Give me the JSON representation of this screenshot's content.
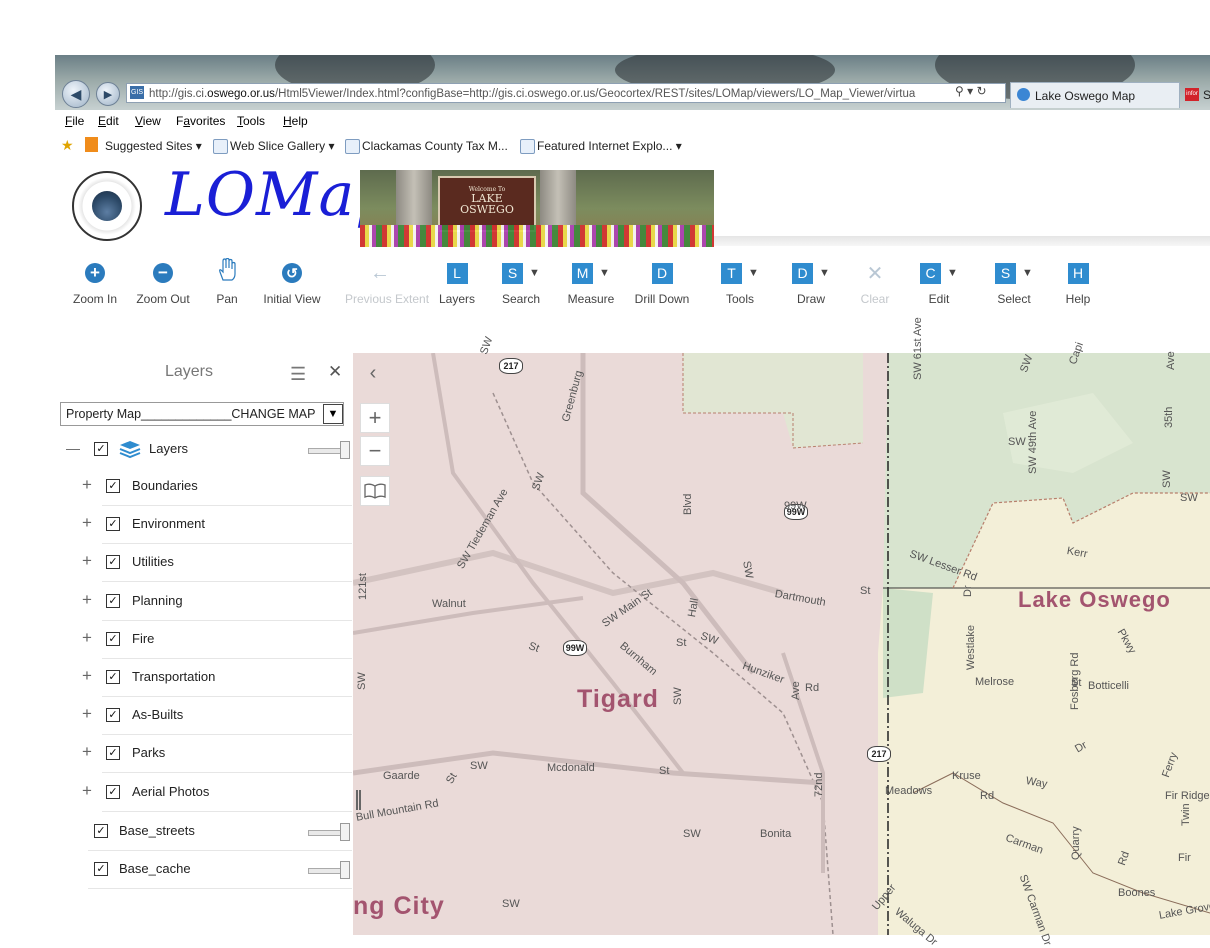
{
  "browser": {
    "url_prefix": "http://gis.ci.",
    "url_domain": "oswego.or.us",
    "url_suffix": "/Html5Viewer/Index.html?configBase=http://gis.ci.oswego.or.us/Geocortex/REST/sites/LOMap/viewers/LO_Map_Viewer/virtua",
    "addr_tools": "⚲ ▾ ↻",
    "site_icon_text": "GIS",
    "active_tab": "Lake Oswego Map",
    "second_tab": "S",
    "second_tab_icon_text": "infor",
    "menu": [
      "File",
      "Edit",
      "View",
      "Favorites",
      "Tools",
      "Help"
    ],
    "menu_underline": [
      "F",
      "E",
      "V",
      "a",
      "T",
      "H"
    ],
    "favorites": [
      {
        "label": "Suggested Sites ▾"
      },
      {
        "label": "Web Slice Gallery ▾"
      },
      {
        "label": "Clackamas County Tax M..."
      },
      {
        "label": "Featured Internet Explo... ▾"
      }
    ]
  },
  "header": {
    "logo_text": "LOMap",
    "banner_top": "Welcome To",
    "banner_line1": "LAKE",
    "banner_line2": "OSWEGO"
  },
  "toolbar": [
    {
      "label": "Zoom In",
      "icon": "+",
      "kind": "round",
      "enabled": true
    },
    {
      "label": "Zoom Out",
      "icon": "−",
      "kind": "round",
      "enabled": true
    },
    {
      "label": "Pan",
      "icon": "hand",
      "kind": "glyph",
      "enabled": true
    },
    {
      "label": "Initial View",
      "icon": "↺",
      "kind": "round",
      "enabled": true
    },
    {
      "label": "Previous Extent",
      "icon": "←",
      "kind": "glyph",
      "enabled": false
    },
    {
      "label": "Layers",
      "icon": "L",
      "kind": "sq",
      "enabled": true,
      "dropdown": false
    },
    {
      "label": "Search",
      "icon": "S",
      "kind": "sq",
      "enabled": true,
      "dropdown": true
    },
    {
      "label": "Measure",
      "icon": "M",
      "kind": "sq",
      "enabled": true,
      "dropdown": true
    },
    {
      "label": "Drill Down",
      "icon": "D",
      "kind": "sq",
      "enabled": true,
      "dropdown": false
    },
    {
      "label": "Tools",
      "icon": "T",
      "kind": "sq",
      "enabled": true,
      "dropdown": true
    },
    {
      "label": "Draw",
      "icon": "D",
      "kind": "sq",
      "enabled": true,
      "dropdown": true
    },
    {
      "label": "Clear",
      "icon": "✕",
      "kind": "glyph",
      "enabled": false
    },
    {
      "label": "Edit",
      "icon": "C",
      "kind": "sq",
      "enabled": true,
      "dropdown": true
    },
    {
      "label": "Select",
      "icon": "S",
      "kind": "sq",
      "enabled": true,
      "dropdown": true
    },
    {
      "label": "Help",
      "icon": "H",
      "kind": "sq",
      "enabled": true,
      "dropdown": false
    }
  ],
  "layers_panel": {
    "title": "Layers",
    "menu_icon": "☰",
    "close_icon": "✕",
    "map_select": "Property Map_____________CHANGE MAP",
    "root_layer": "Layers",
    "groups": [
      "Boundaries",
      "Environment",
      "Utilities",
      "Planning",
      "Fire",
      "Transportation",
      "As-Builts",
      "Parks",
      "Aerial Photos"
    ],
    "base_layers": [
      "Base_streets",
      "Base_cache"
    ]
  },
  "map": {
    "controls": {
      "zoom_in": "+",
      "zoom_out": "−",
      "collapse": "‹"
    },
    "cities": [
      "Tigard",
      "Lake Oswego",
      "ng City"
    ],
    "shields": [
      "217",
      "99W",
      "99W",
      "217"
    ],
    "streets": [
      "SW",
      "Greenburg",
      "SW",
      "Blvd",
      "99W",
      "SW",
      "SW Tiedeman Ave",
      "121st",
      "Walnut",
      "SW Main St",
      "St",
      "Burnham",
      "Hall",
      "SW",
      "Dartmouth",
      "St",
      "Hunziker",
      "Rd",
      "St",
      "SW",
      "Ave",
      "SW",
      "Gaarde",
      "St",
      "SW",
      "Mcdonald",
      "St",
      "Bull Mountain Rd",
      "SW",
      "Bonita",
      "72nd",
      "SW 61st Ave",
      "SW",
      "Capi",
      "Ave",
      "35th",
      "SW",
      "SW 49th Ave",
      "SW",
      "SW",
      "Kerr",
      "SW Lesser Rd",
      "Dr",
      "Westlake",
      "Melrose",
      "St",
      "Botticelli",
      "Pkwy",
      "Fosberg Rd",
      "Dr",
      "Meadows",
      "Rd",
      "Kruse",
      "Way",
      "Ferry",
      "Fir Ridge",
      "Twin",
      "Fir",
      "Carman",
      "Quarry",
      "Rd",
      "Boones",
      "Lake Grove Ave",
      "Upper",
      "SW Carman Dr",
      "Waluga Dr",
      "SW"
    ]
  },
  "colors": {
    "accent": "#2f8ccf",
    "city_label": "#a3546f",
    "logo": "#1a1fd6"
  }
}
